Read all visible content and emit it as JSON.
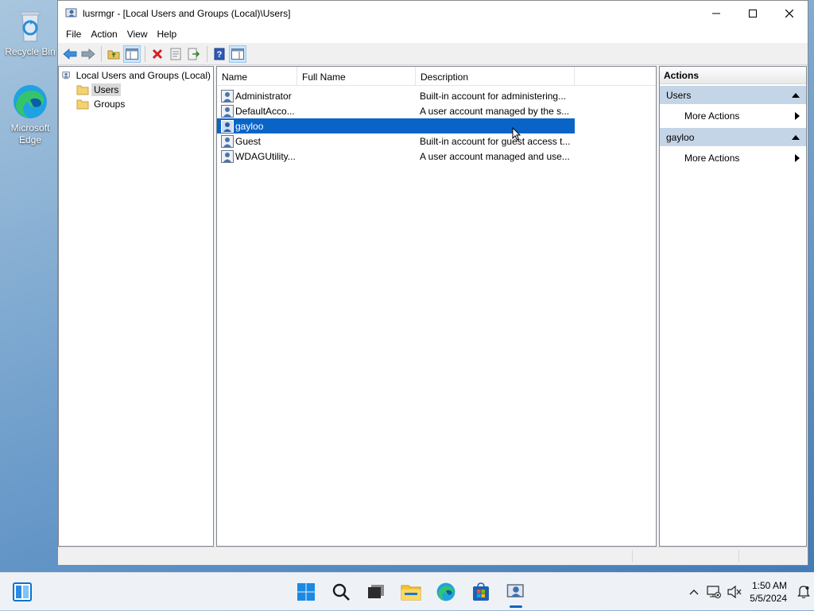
{
  "desktop": {
    "icons": [
      {
        "label": "Recycle Bin",
        "icon": "recycle-bin-icon"
      },
      {
        "label": "Microsoft Edge",
        "icon": "edge-icon"
      }
    ]
  },
  "window": {
    "title": "lusrmgr - [Local Users and Groups (Local)\\Users]",
    "controls": [
      "minimize",
      "maximize",
      "close"
    ]
  },
  "menu": {
    "items": [
      "File",
      "Action",
      "View",
      "Help"
    ]
  },
  "toolbar": {
    "buttons": [
      "back",
      "forward",
      "up-one-level",
      "show-hide-console-tree",
      "delete",
      "properties",
      "export-list",
      "help",
      "show-hide-action-pane"
    ]
  },
  "tree": {
    "root": "Local Users and Groups (Local)",
    "children": [
      {
        "label": "Users",
        "selected": true
      },
      {
        "label": "Groups",
        "selected": false
      }
    ]
  },
  "list": {
    "columns": [
      "Name",
      "Full Name",
      "Description"
    ],
    "rows": [
      {
        "name": "Administrator",
        "full_name": "",
        "description": "Built-in account for administering..."
      },
      {
        "name": "DefaultAcco...",
        "full_name": "",
        "description": "A user account managed by the s..."
      },
      {
        "name": "gayloo",
        "full_name": "",
        "description": "",
        "selected": true
      },
      {
        "name": "Guest",
        "full_name": "",
        "description": "Built-in account for guest access t..."
      },
      {
        "name": "WDAGUtility...",
        "full_name": "",
        "description": "A user account managed and use..."
      }
    ]
  },
  "actions_pane": {
    "header": "Actions",
    "sections": [
      {
        "title": "Users",
        "items": [
          "More Actions"
        ]
      },
      {
        "title": "gayloo",
        "items": [
          "More Actions"
        ]
      }
    ]
  },
  "taskbar": {
    "apps": [
      "start",
      "search",
      "task-view",
      "file-explorer",
      "edge",
      "store",
      "lusrmgr"
    ],
    "active_app": "lusrmgr",
    "time": "1:50 AM",
    "date": "5/5/2024"
  },
  "colors": {
    "selection": "#0a64c8",
    "accent": "#0067c0",
    "section_header": "#c5d5e8"
  }
}
